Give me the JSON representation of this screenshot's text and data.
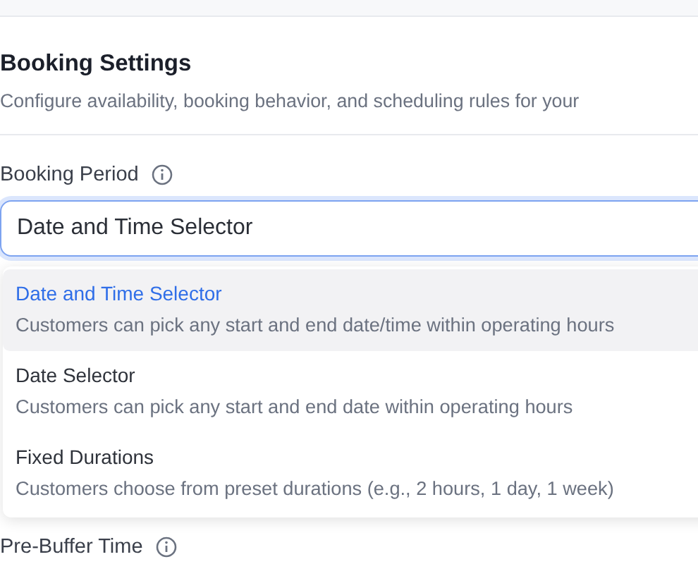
{
  "section": {
    "title": "Booking Settings",
    "subtitle": "Configure availability, booking behavior, and scheduling rules for your"
  },
  "booking_period": {
    "label": "Booking Period",
    "value": "Date and Time Selector",
    "expanded": true,
    "options": [
      {
        "title": "Date and Time Selector",
        "description": "Customers can pick any start and end date/time within operating hours",
        "selected": true
      },
      {
        "title": "Date Selector",
        "description": "Customers can pick any start and end date within operating hours",
        "selected": false
      },
      {
        "title": "Fixed Durations",
        "description": "Customers choose from preset durations (e.g., 2 hours, 1 day, 1 week)",
        "selected": false
      }
    ]
  },
  "pre_buffer": {
    "label": "Pre-Buffer Time"
  }
}
